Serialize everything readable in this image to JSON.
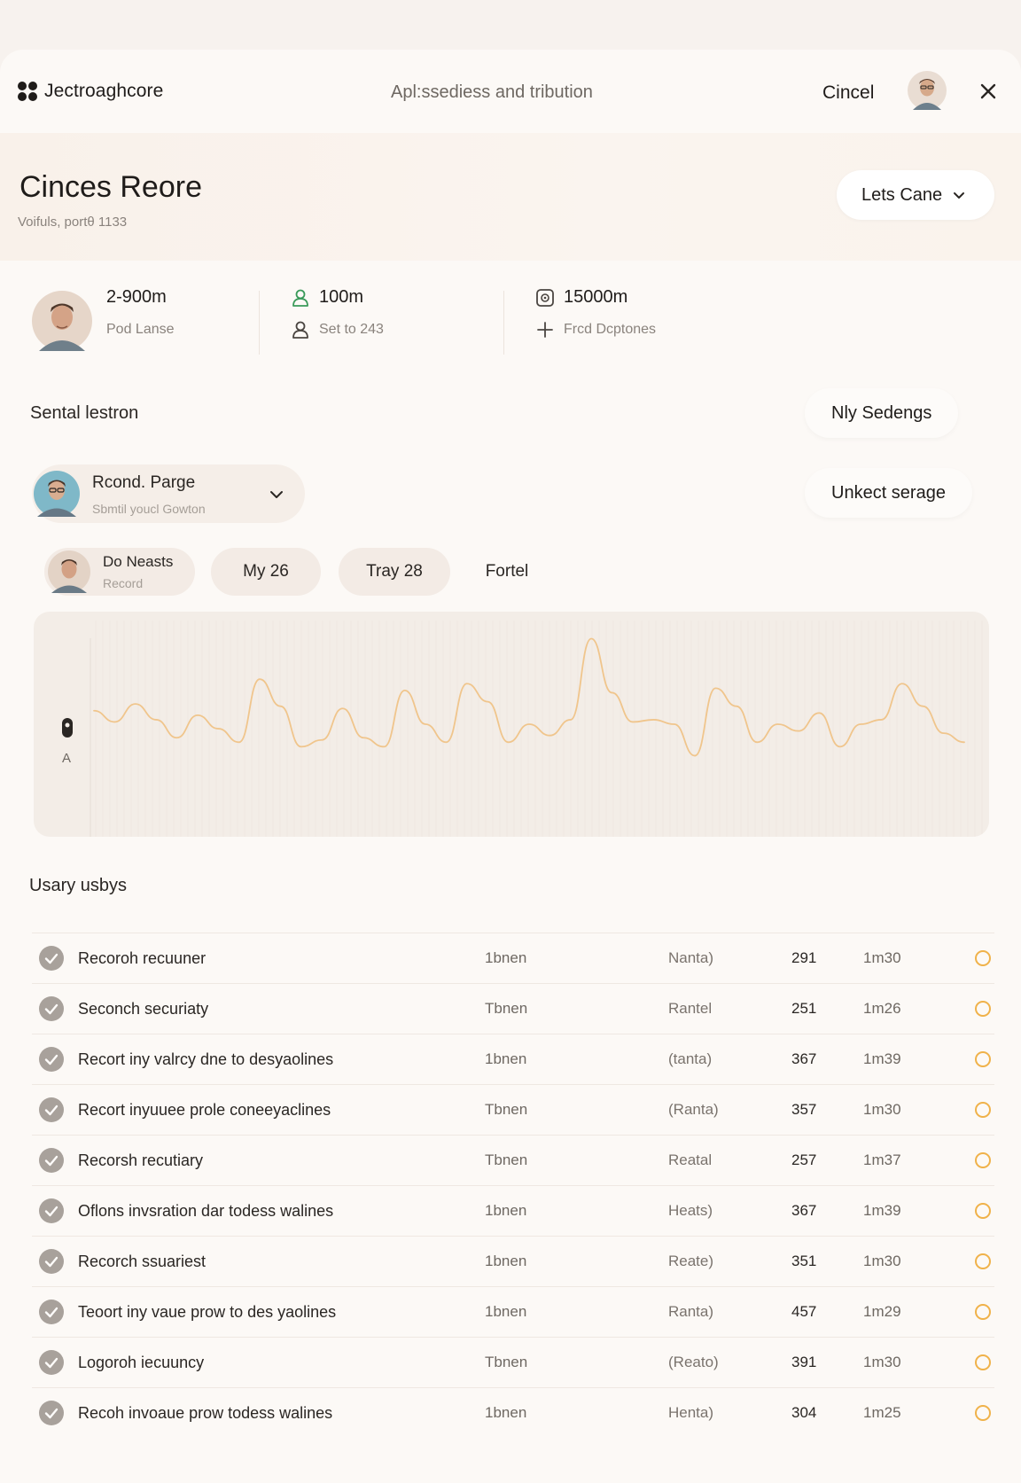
{
  "app": {
    "brand": "Jectroaghcore",
    "center_title": "Apl:ssediess and tribution",
    "cancel_label": "Cincel"
  },
  "header": {
    "title": "Cinces Reore",
    "subtitle": "Voifuls, portθ 1133",
    "select_label": "Lets Cane"
  },
  "stats": [
    {
      "primary": "2-900m",
      "secondary": "Pod Lanse"
    },
    {
      "primary": "100m",
      "secondary": "Set to 243"
    },
    {
      "primary": "15000m",
      "secondary": "Frcd Dcptones"
    }
  ],
  "session": {
    "title": "Sental lestron",
    "settings_button": "Nly Sedengs",
    "unlock_button": "Unkect serage",
    "profile_name": "Rcond. Parge",
    "profile_sub": "Sbmtil youcl Gowton"
  },
  "chips": {
    "record_name": "Do Neasts",
    "record_sub": "Record",
    "chip1": "My 26",
    "chip2": "Tray 28",
    "chip3": "Fortel"
  },
  "chart_data": {
    "type": "line",
    "marker_label": "A",
    "line_color": "#f0c58c",
    "series": [
      {
        "values": [
          0.44,
          0.49,
          0.41,
          0.48,
          0.56,
          0.46,
          0.52,
          0.58,
          0.3,
          0.42,
          0.6,
          0.57,
          0.43,
          0.56,
          0.6,
          0.35,
          0.5,
          0.58,
          0.32,
          0.4,
          0.58,
          0.5,
          0.55,
          0.48,
          0.12,
          0.36,
          0.49,
          0.48,
          0.5,
          0.64,
          0.34,
          0.42,
          0.58,
          0.5,
          0.53,
          0.45,
          0.6,
          0.5,
          0.48,
          0.32,
          0.42,
          0.54,
          0.58
        ]
      }
    ]
  },
  "table": {
    "title": "Usary usbys",
    "rows": [
      {
        "name": "Recoroh recuuner",
        "type": "1bnen",
        "status": "Nanta)",
        "count": "291",
        "duration": "1m30"
      },
      {
        "name": "Seconch securiaty",
        "type": "Tbnen",
        "status": "Rantel",
        "count": "251",
        "duration": "1m26"
      },
      {
        "name": "Recort iny valrcy dne to desyaolines",
        "type": "1bnen",
        "status": "(tanta)",
        "count": "367",
        "duration": "1m39"
      },
      {
        "name": "Recort inyuuee prole coneeyaclines",
        "type": "Tbnen",
        "status": "(Ranta)",
        "count": "357",
        "duration": "1m30"
      },
      {
        "name": "Recorsh recutiary",
        "type": "Tbnen",
        "status": "Reatal",
        "count": "257",
        "duration": "1m37"
      },
      {
        "name": "Oflons invsration dar todess walines",
        "type": "1bnen",
        "status": "Heats)",
        "count": "367",
        "duration": "1m39"
      },
      {
        "name": "Recorch ssuariest",
        "type": "1bnen",
        "status": "Reate)",
        "count": "351",
        "duration": "1m30"
      },
      {
        "name": "Teoort iny vaue prow to des yaolines",
        "type": "1bnen",
        "status": "Ranta)",
        "count": "457",
        "duration": "1m29"
      },
      {
        "name": "Logoroh iecuuncy",
        "type": "Tbnen",
        "status": "(Reato)",
        "count": "391",
        "duration": "1m30"
      },
      {
        "name": "Recoh invoaue prow todess walines",
        "type": "1bnen",
        "status": "Henta)",
        "count": "304",
        "duration": "1m25"
      }
    ]
  }
}
